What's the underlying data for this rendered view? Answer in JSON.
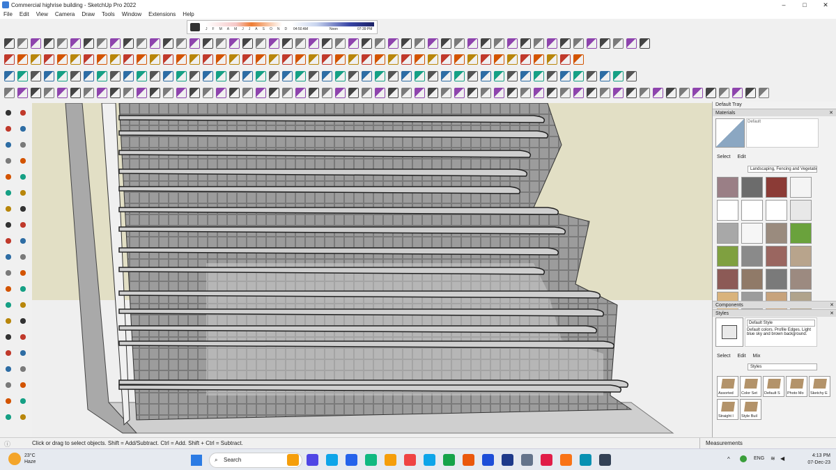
{
  "window": {
    "title": "Commercial highrise building - SketchUp Pro 2022",
    "minimize": "–",
    "maximize": "□",
    "close": "✕"
  },
  "menu": [
    "File",
    "Edit",
    "View",
    "Camera",
    "Draw",
    "Tools",
    "Window",
    "Extensions",
    "Help"
  ],
  "shadow_settings": {
    "months": [
      "J",
      "F",
      "M",
      "A",
      "M",
      "J",
      "J",
      "A",
      "S",
      "O",
      "N",
      "D"
    ],
    "sunrise": "04:50 AM",
    "noon": "Noon",
    "sunset": "07:39 PM"
  },
  "tray": {
    "title": "Default Tray",
    "materials": {
      "header": "Materials",
      "current": "Default",
      "tab_select": "Select",
      "tab_edit": "Edit",
      "library": "Landscaping, Fencing and Vegetation",
      "swatch_colors": [
        "#9a7f86",
        "#6c6c6c",
        "#8b3b36",
        "#f4f4f4",
        "#ffffff",
        "#ffffff",
        "#ffffff",
        "#e8e8e8",
        "#a8a8a8",
        "#f6f6f6",
        "#9a8b7e",
        "#6aa23c",
        "#7fa040",
        "#8a8a8a",
        "#9a6660",
        "#b8a48c",
        "#8c5a56",
        "#907a68",
        "#7a7a7a",
        "#9c8a80",
        "#d9b37c",
        "#9c9c9c",
        "#c7a37c",
        "#b0a38c"
      ]
    },
    "components": {
      "header": "Components"
    },
    "styles": {
      "header": "Styles",
      "current": "Default Style",
      "description": "Default colors. Profile Edges. Light blue sky and brown background.",
      "tab_select": "Select",
      "tab_edit": "Edit",
      "tab_mix": "Mix",
      "library": "Styles",
      "items": [
        "Assorted",
        "Color Set",
        "Default S",
        "Photo Mo",
        "Sketchy E",
        "Straight l",
        "Style Buil"
      ]
    }
  },
  "status": {
    "hint": "Click or drag to select objects. Shift = Add/Subtract. Ctrl = Add. Shift + Ctrl = Subtract.",
    "measurements_label": "Measurements"
  },
  "taskbar": {
    "temperature": "23°C",
    "condition": "Haze",
    "search_placeholder": "Search",
    "time": "4:13 PM",
    "date": "07-Dec-23",
    "language": "ENG"
  }
}
